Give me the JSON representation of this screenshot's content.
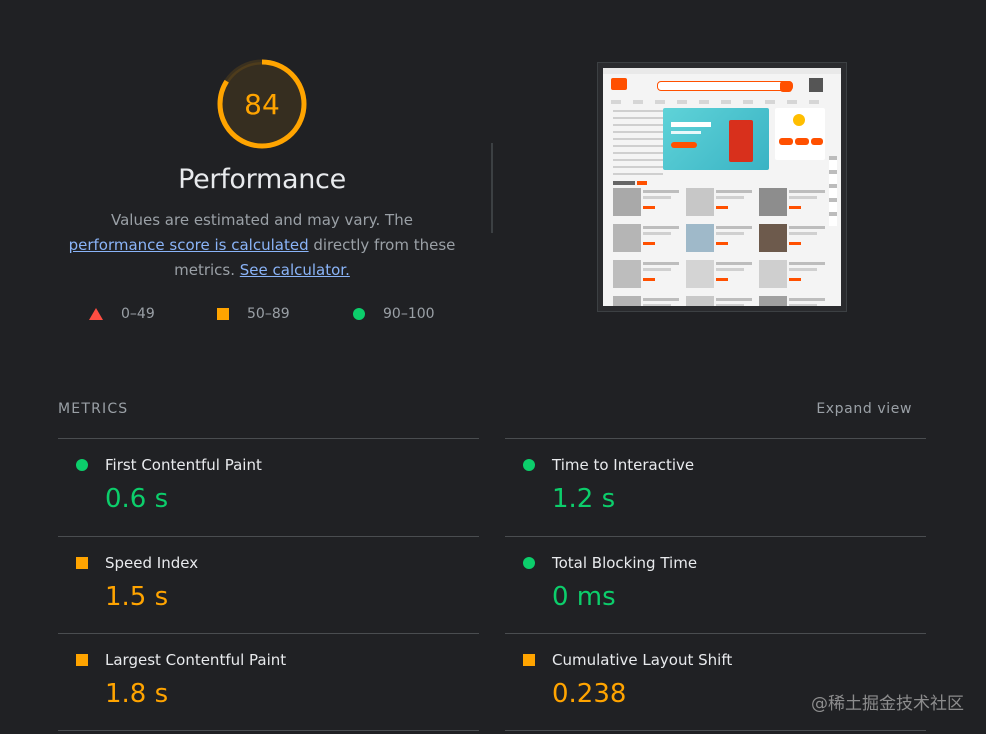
{
  "score": {
    "value": "84",
    "fraction": 0.84,
    "color": "#ffa400"
  },
  "category": {
    "title": "Performance"
  },
  "description": {
    "prefix": "Values are estimated and may vary. The ",
    "link1": "performance score is calculated",
    "middle": " directly from these metrics. ",
    "link2": "See calculator."
  },
  "legend": [
    {
      "range": "0–49",
      "shape": "triangle",
      "color": "#ff4e42"
    },
    {
      "range": "50–89",
      "shape": "square",
      "color": "#ffa400"
    },
    {
      "range": "90–100",
      "shape": "circle",
      "color": "#0cce6b"
    }
  ],
  "metrics": {
    "header": "METRICS",
    "expand_label": "Expand view",
    "items": [
      {
        "name": "First Contentful Paint",
        "value": "0.6 s",
        "rating": "pass"
      },
      {
        "name": "Time to Interactive",
        "value": "1.2 s",
        "rating": "pass"
      },
      {
        "name": "Speed Index",
        "value": "1.5 s",
        "rating": "average"
      },
      {
        "name": "Total Blocking Time",
        "value": "0 ms",
        "rating": "pass"
      },
      {
        "name": "Largest Contentful Paint",
        "value": "1.8 s",
        "rating": "average"
      },
      {
        "name": "Cumulative Layout Shift",
        "value": "0.238",
        "rating": "average"
      }
    ]
  },
  "colors": {
    "pass": "#0cce6b",
    "average": "#ffa400",
    "fail": "#ff4e42",
    "link": "#8ab4f8"
  },
  "watermark": "@稀土掘金技术社区"
}
